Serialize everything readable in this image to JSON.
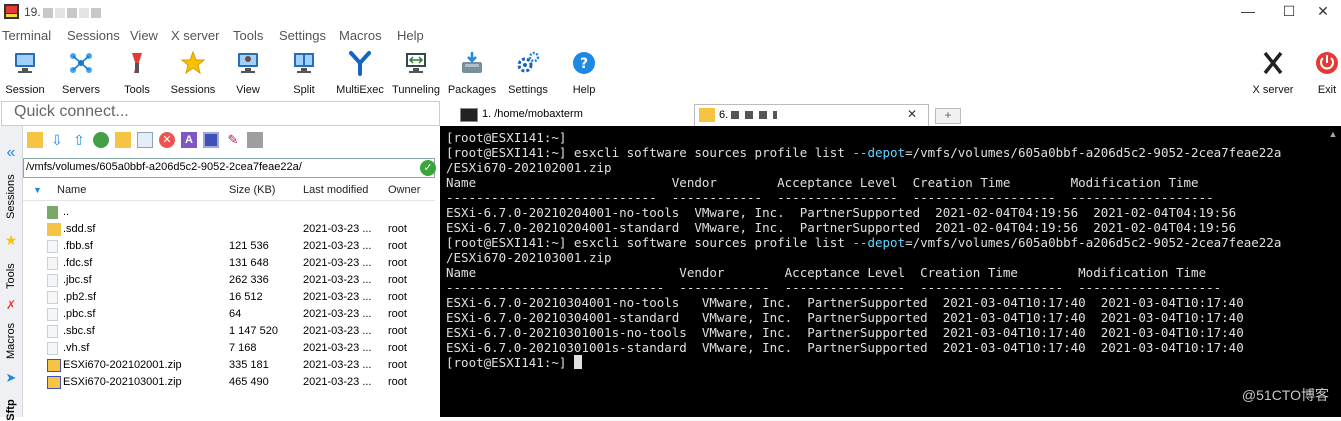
{
  "window": {
    "title": "19."
  },
  "menu": [
    "Terminal",
    "Sessions",
    "View",
    "X server",
    "Tools",
    "Settings",
    "Macros",
    "Help"
  ],
  "toolbar": {
    "session": "Session",
    "servers": "Servers",
    "tools": "Tools",
    "sessions": "Sessions",
    "view": "View",
    "split": "Split",
    "multiexec": "MultiExec",
    "tunneling": "Tunneling",
    "packages": "Packages",
    "settings": "Settings",
    "help": "Help",
    "xserver": "X server",
    "exit": "Exit"
  },
  "quick_connect": {
    "placeholder": "Quick connect..."
  },
  "side_tabs": {
    "sessions": "Sessions",
    "tools": "Tools",
    "macros": "Macros",
    "sftp": "Sftp"
  },
  "sftp": {
    "path": "/vmfs/volumes/605a0bbf-a206d5c2-9052-2cea7feae22a/",
    "columns": {
      "name": "Name",
      "size": "Size (KB)",
      "modified": "Last modified",
      "owner": "Owner"
    },
    "files": [
      {
        "name": "..",
        "size": "",
        "modified": "",
        "owner": ""
      },
      {
        "name": ".sdd.sf",
        "size": "",
        "modified": "2021-03-23 ...",
        "owner": "root"
      },
      {
        "name": ".fbb.sf",
        "size": "121 536",
        "modified": "2021-03-23 ...",
        "owner": "root"
      },
      {
        "name": ".fdc.sf",
        "size": "131 648",
        "modified": "2021-03-23 ...",
        "owner": "root"
      },
      {
        "name": ".jbc.sf",
        "size": "262 336",
        "modified": "2021-03-23 ...",
        "owner": "root"
      },
      {
        "name": ".pb2.sf",
        "size": "16 512",
        "modified": "2021-03-23 ...",
        "owner": "root"
      },
      {
        "name": ".pbc.sf",
        "size": "64",
        "modified": "2021-03-23 ...",
        "owner": "root"
      },
      {
        "name": ".sbc.sf",
        "size": "1 147 520",
        "modified": "2021-03-23 ...",
        "owner": "root"
      },
      {
        "name": ".vh.sf",
        "size": "7 168",
        "modified": "2021-03-23 ...",
        "owner": "root"
      },
      {
        "name": "ESXi670-202102001.zip",
        "size": "335 181",
        "modified": "2021-03-23 ...",
        "owner": "root"
      },
      {
        "name": "ESXi670-202103001.zip",
        "size": "465 490",
        "modified": "2021-03-23 ...",
        "owner": "root"
      }
    ]
  },
  "tabs": {
    "tab1": "1. /home/mobaxterm",
    "tab2": "6."
  },
  "terminal": {
    "l1": "[root@ESXI141:~]",
    "l2a": "[root@ESXI141:~] esxcli software sources profile list ",
    "l2b": "--depot",
    "l2c": "=/vmfs/volumes/605a0bbf-a206d5c2-9052-2cea7feae22a",
    "l3": "/ESXi670-202102001.zip",
    "l4": "Name                          Vendor        Acceptance Level  Creation Time        Modification Time",
    "l5": "----------------------------  ------------  ----------------  -------------------  -------------------",
    "l6": "ESXi-6.7.0-20210204001-no-tools  VMware, Inc.  PartnerSupported  2021-02-04T04:19:56  2021-02-04T04:19:56",
    "l7": "ESXi-6.7.0-20210204001-standard  VMware, Inc.  PartnerSupported  2021-02-04T04:19:56  2021-02-04T04:19:56",
    "l8a": "[root@ESXI141:~] esxcli software sources profile list ",
    "l8b": "--depot",
    "l8c": "=/vmfs/volumes/605a0bbf-a206d5c2-9052-2cea7feae22a",
    "l9": "/ESXi670-202103001.zip",
    "l10": "Name                           Vendor        Acceptance Level  Creation Time        Modification Time",
    "l11": "-----------------------------  ------------  ----------------  -------------------  -------------------",
    "l12": "ESXi-6.7.0-20210304001-no-tools   VMware, Inc.  PartnerSupported  2021-03-04T10:17:40  2021-03-04T10:17:40",
    "l13": "ESXi-6.7.0-20210304001-standard   VMware, Inc.  PartnerSupported  2021-03-04T10:17:40  2021-03-04T10:17:40",
    "l14": "ESXi-6.7.0-20210301001s-no-tools  VMware, Inc.  PartnerSupported  2021-03-04T10:17:40  2021-03-04T10:17:40",
    "l15": "ESXi-6.7.0-20210301001s-standard  VMware, Inc.  PartnerSupported  2021-03-04T10:17:40  2021-03-04T10:17:40",
    "l16": "[root@ESXI141:~] "
  },
  "watermark": "@51CTO博客",
  "colors": {
    "terminal_bg": "#000000",
    "terminal_text": "#e0e0e0",
    "depot_flag": "#5fd7ff",
    "exit_red": "#e53935"
  }
}
